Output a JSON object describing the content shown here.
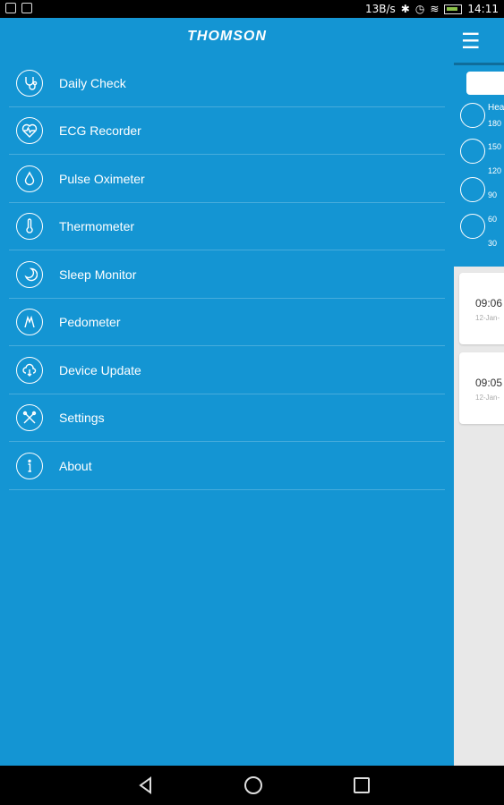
{
  "status_bar": {
    "net_speed": "13B/s",
    "time": "14:11"
  },
  "drawer": {
    "brand": "THOMSON",
    "items": [
      {
        "label": "Daily Check",
        "icon": "stethoscope-icon"
      },
      {
        "label": "ECG Recorder",
        "icon": "heart-ecg-icon"
      },
      {
        "label": "Pulse Oximeter",
        "icon": "drop-icon"
      },
      {
        "label": "Thermometer",
        "icon": "thermometer-icon"
      },
      {
        "label": "Sleep Monitor",
        "icon": "moon-icon"
      },
      {
        "label": "Pedometer",
        "icon": "footsteps-icon"
      },
      {
        "label": "Device Update",
        "icon": "cloud-download-icon"
      },
      {
        "label": "Settings",
        "icon": "tools-icon"
      },
      {
        "label": "About",
        "icon": "info-icon"
      }
    ]
  },
  "background_app": {
    "menu_icon": "☰",
    "chart_label": "Hea",
    "y_ticks": [
      "180",
      "150",
      "120",
      "90",
      "60",
      "30"
    ],
    "cards": [
      {
        "time": "09:06",
        "date": "12-Jan-"
      },
      {
        "time": "09:05",
        "date": "12-Jan-"
      }
    ]
  },
  "colors": {
    "primary": "#1495d3",
    "background": "#e8e8e8"
  }
}
